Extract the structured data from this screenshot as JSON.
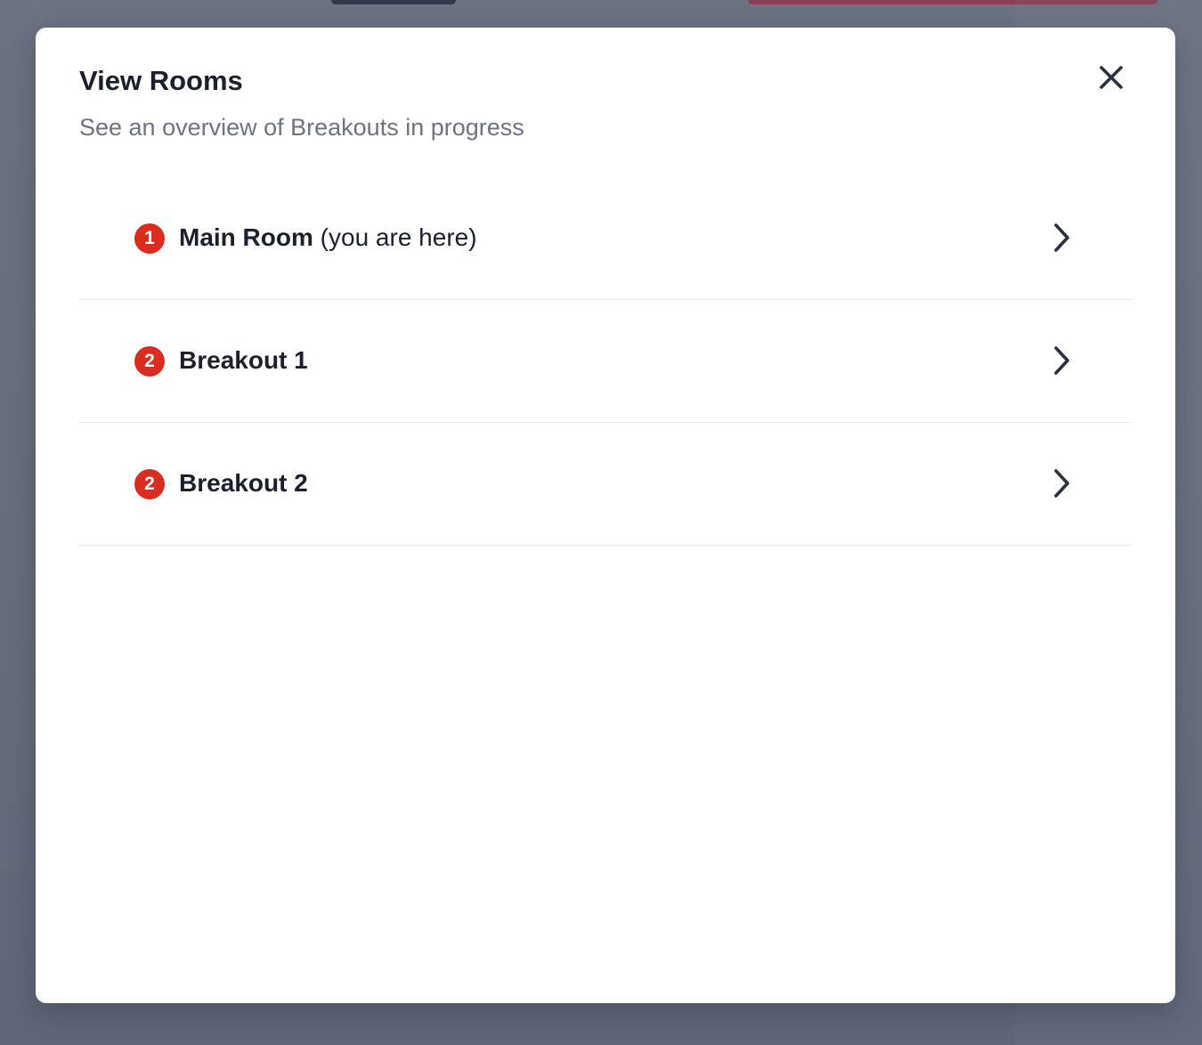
{
  "modal": {
    "title": "View Rooms",
    "subtitle": "See an overview of Breakouts in progress",
    "close_icon": "close-icon"
  },
  "rooms": [
    {
      "count": "1",
      "name": "Main Room",
      "note": "(you are here)",
      "icon": "chevron-right-icon"
    },
    {
      "count": "2",
      "name": "Breakout 1",
      "note": "",
      "icon": "chevron-right-icon"
    },
    {
      "count": "2",
      "name": "Breakout 2",
      "note": "",
      "icon": "chevron-right-icon"
    }
  ],
  "colors": {
    "badge": "#d92d20",
    "text": "#1b1f2e",
    "subtitle": "#6e7382",
    "overlay": "#646b7a"
  }
}
